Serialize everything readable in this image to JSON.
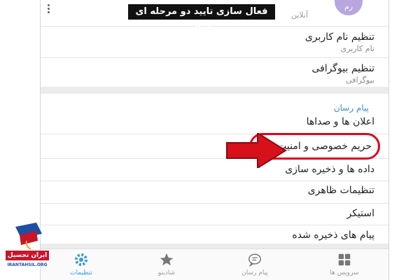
{
  "header": {
    "title_banner": "فعال سازی تایید دو مرحله ای شاد",
    "avatar_text": "رم",
    "status": "آنلاین"
  },
  "account": [
    {
      "label": "تنظیم نام کاربری",
      "sub": "نام کاربری"
    },
    {
      "label": "تنظیم بیوگرافی",
      "sub": "بیوگرافی"
    }
  ],
  "messenger": {
    "section_title": "پیام رسان",
    "items": [
      "اعلان ها و صداها",
      "حریم خصوصی و امنیت",
      "داده ها و ذخیره سازی",
      "تنظیمات ظاهری",
      "استیکر",
      "پیام های ذخیره شده"
    ]
  },
  "bottom_nav": {
    "settings": "تنظیمات",
    "shadino": "شادینو",
    "messenger": "پیام رسان",
    "services": "سرویس ها"
  },
  "logo": {
    "name": "ایران تحصیل",
    "url": "IRANTAHSIL.ORG"
  },
  "colors": {
    "accent": "#3a9ad8",
    "highlight": "#e3001b",
    "arrow": "#d6111c"
  }
}
